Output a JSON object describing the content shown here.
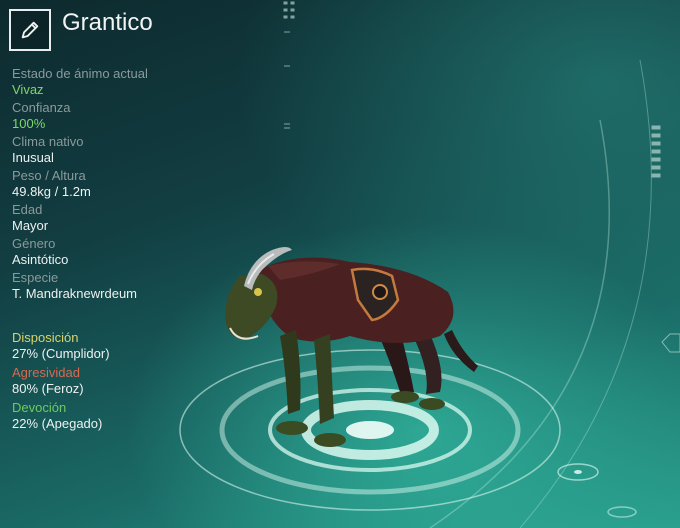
{
  "creature": {
    "name": "Grantico"
  },
  "stats": [
    {
      "label": "Estado de ánimo actual",
      "value": "Vivaz",
      "value_color": "green"
    },
    {
      "label": "Confianza",
      "value": "100%",
      "value_color": "green"
    },
    {
      "label": "Clima nativo",
      "value": "Inusual"
    },
    {
      "label": "Peso / Altura",
      "value": "49.8kg / 1.2m"
    },
    {
      "label": "Edad",
      "value": "Mayor"
    },
    {
      "label": "Género",
      "value": "Asintótico"
    },
    {
      "label": "Especie",
      "value": "T. Mandraknewrdeum"
    }
  ],
  "temperament": [
    {
      "label": "Disposición",
      "value": "27% (Cumplidor)",
      "color": "#d8d36a"
    },
    {
      "label": "Agresividad",
      "value": "80% (Feroz)",
      "color": "#d86a52"
    },
    {
      "label": "Devoción",
      "value": "22% (Apegado)",
      "color": "#6fcb5c"
    }
  ],
  "icons": {
    "edit": "pencil-icon"
  }
}
